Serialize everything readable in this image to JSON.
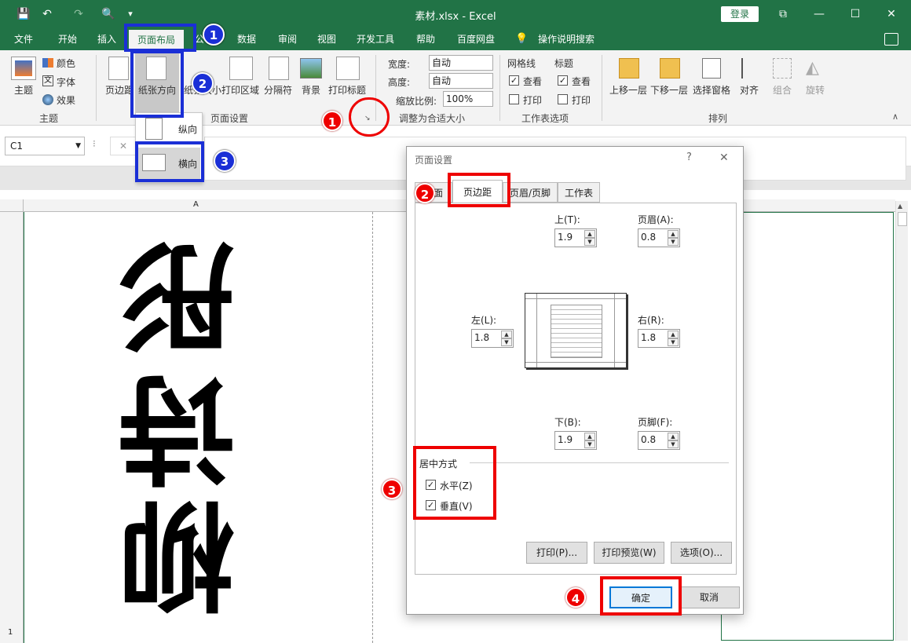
{
  "title_bar": {
    "title": "素材.xlsx  -  Excel",
    "login": "登录",
    "qa_save": "💾",
    "qa_undo": "↶",
    "qa_redo": "↷",
    "qa_preview": "🔍",
    "qa_more": "▾",
    "restore": "⧉",
    "minimize": "—",
    "maximize": "☐",
    "close": "✕"
  },
  "menu_tabs": [
    "文件",
    "开始",
    "插入",
    "页面布局",
    "公",
    "数据",
    "审阅",
    "视图",
    "开发工具",
    "帮助",
    "百度网盘",
    "操作说明搜索"
  ],
  "ribbon": {
    "themes": {
      "theme": "主题",
      "colors": "颜色",
      "fonts": "字体",
      "effects": "效果",
      "group": "主题"
    },
    "page_setup": {
      "margins": "页边距",
      "orientation": "纸张方向",
      "size": "纸张大小",
      "print_area": "打印区域",
      "breaks": "分隔符",
      "background": "背景",
      "print_titles": "打印标题",
      "group": "页面设置"
    },
    "scale": {
      "width_label": "宽度:",
      "width_value": "自动",
      "height_label": "高度:",
      "height_value": "自动",
      "scale_label": "缩放比例:",
      "scale_value": "100%",
      "group": "调整为合适大小"
    },
    "sheet_options": {
      "gridlines": "网格线",
      "headings": "标题",
      "view": "查看",
      "print": "打印",
      "group": "工作表选项"
    },
    "arrange": {
      "bring_forward": "上移一层",
      "send_backward": "下移一层",
      "selection_pane": "选择窗格",
      "align": "对齐",
      "group_btn": "组合",
      "rotate": "旋转",
      "group": "排列"
    }
  },
  "orientation_menu": {
    "portrait": "纵向",
    "landscape": "横向"
  },
  "formula_bar": {
    "name_box": "C1",
    "cancel": "✕"
  },
  "sheet": {
    "col_a": "A",
    "row_1": "1",
    "chars": [
      "柳",
      "诗",
      "彤"
    ]
  },
  "dialog": {
    "title": "页面设置",
    "help": "?",
    "close": "✕",
    "tabs": [
      "页面",
      "页边距",
      "页眉/页脚",
      "工作表"
    ],
    "top_label": "上(T):",
    "top_value": "1.9",
    "header_label": "页眉(A):",
    "header_value": "0.8",
    "left_label": "左(L):",
    "left_value": "1.8",
    "right_label": "右(R):",
    "right_value": "1.8",
    "bottom_label": "下(B):",
    "bottom_value": "1.9",
    "footer_label": "页脚(F):",
    "footer_value": "0.8",
    "center_title": "居中方式",
    "horizontal": "水平(Z)",
    "vertical": "垂直(V)",
    "print_btn": "打印(P)...",
    "preview_btn": "打印预览(W)",
    "options_btn": "选项(O)...",
    "ok": "确定",
    "cancel": "取消"
  },
  "badges": {
    "one": "1",
    "two": "2",
    "three": "3",
    "four": "4"
  },
  "colors": {
    "excel_green": "#217346",
    "annotation_red": "#e00000",
    "annotation_blue": "#1a2fd6"
  }
}
